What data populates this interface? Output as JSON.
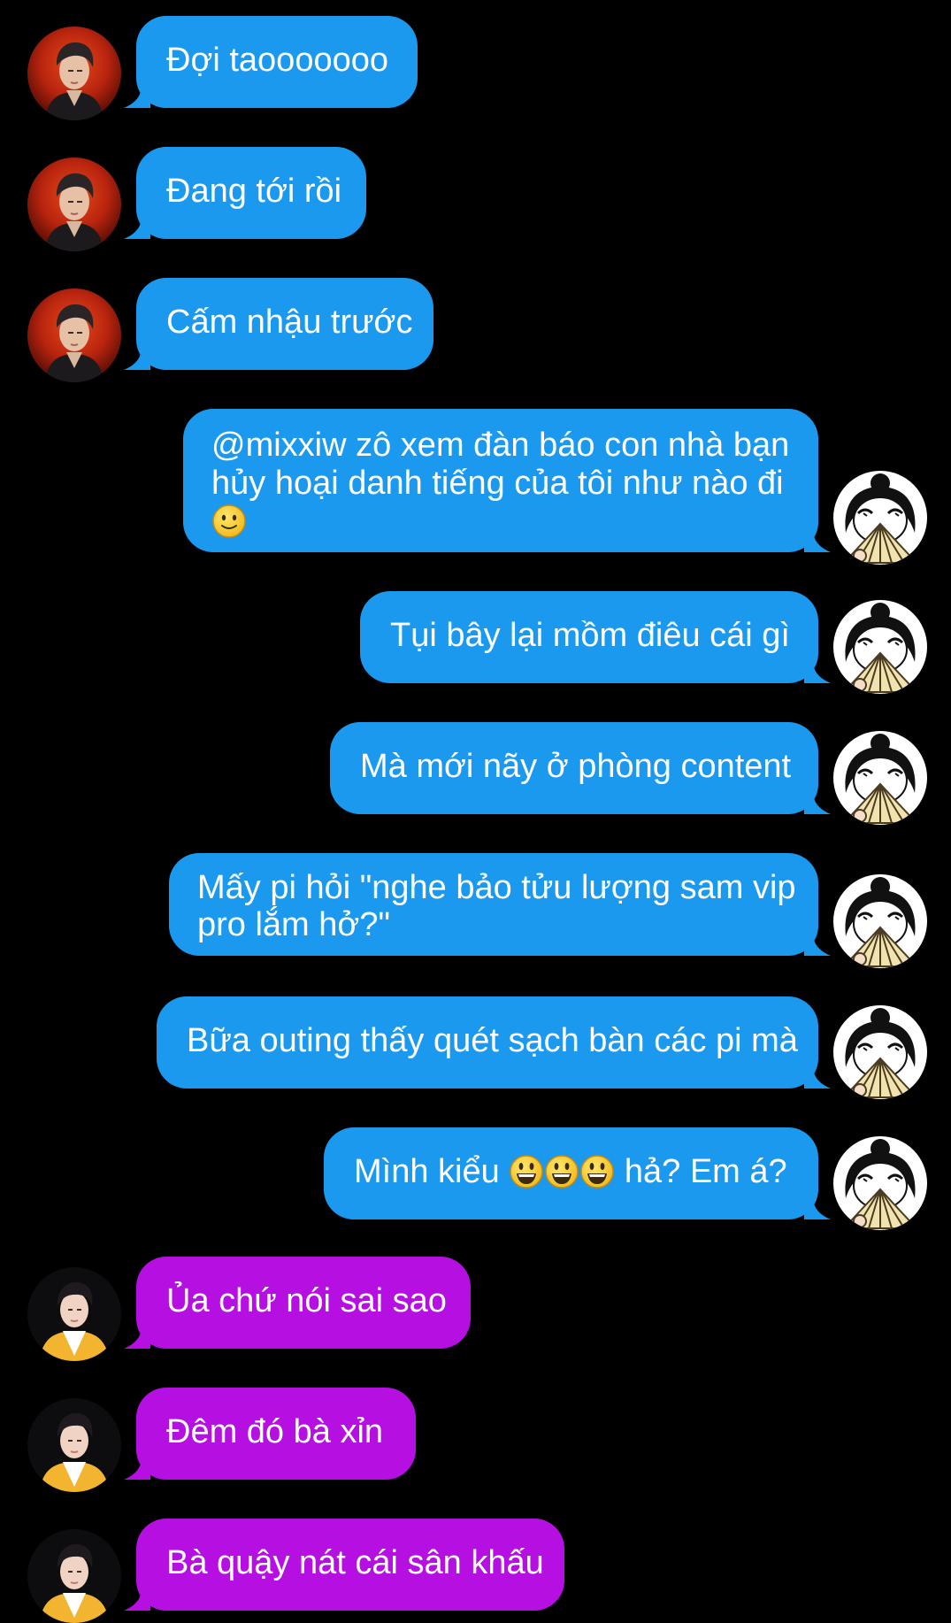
{
  "colors": {
    "background": "#000000",
    "bubble_blue": "#1a99ee",
    "bubble_purple": "#b50fe2",
    "text": "#ffffff"
  },
  "messages": [
    {
      "sender": "man-red",
      "text": "Đợi taooooooo"
    },
    {
      "sender": "man-red",
      "text": "Đang tới rồi"
    },
    {
      "sender": "man-red",
      "text": "Cấm nhậu trước"
    },
    {
      "sender": "me",
      "text_line1": "@mixxiw zô xem đàn báo con nhà bạn",
      "text_line2": "hủy hoại danh tiếng của tôi như nào đi",
      "emoji": "slight-smile-emoji"
    },
    {
      "sender": "me",
      "text": "Tụi bây lại mồm điêu cái gì"
    },
    {
      "sender": "me",
      "text": "Mà mới nãy ở phòng content"
    },
    {
      "sender": "me",
      "text_line1": "Mấy pi hỏi \"nghe bảo tửu lượng sam vip",
      "text_line2": "pro lắm hở?\""
    },
    {
      "sender": "me",
      "text": "Bữa outing thấy quét sạch bàn các pi mà"
    },
    {
      "sender": "me",
      "text_before": "Mình kiểu",
      "emojis": [
        "grinning-emoji",
        "grinning-emoji",
        "grinning-emoji"
      ],
      "text_after": "hả? Em á?"
    },
    {
      "sender": "man-yellow",
      "text": "Ủa chứ nói sai sao"
    },
    {
      "sender": "man-yellow",
      "text": "Đêm đó bà xỉn"
    },
    {
      "sender": "man-yellow",
      "text": "Bà quậy nát cái sân khấu"
    }
  ]
}
